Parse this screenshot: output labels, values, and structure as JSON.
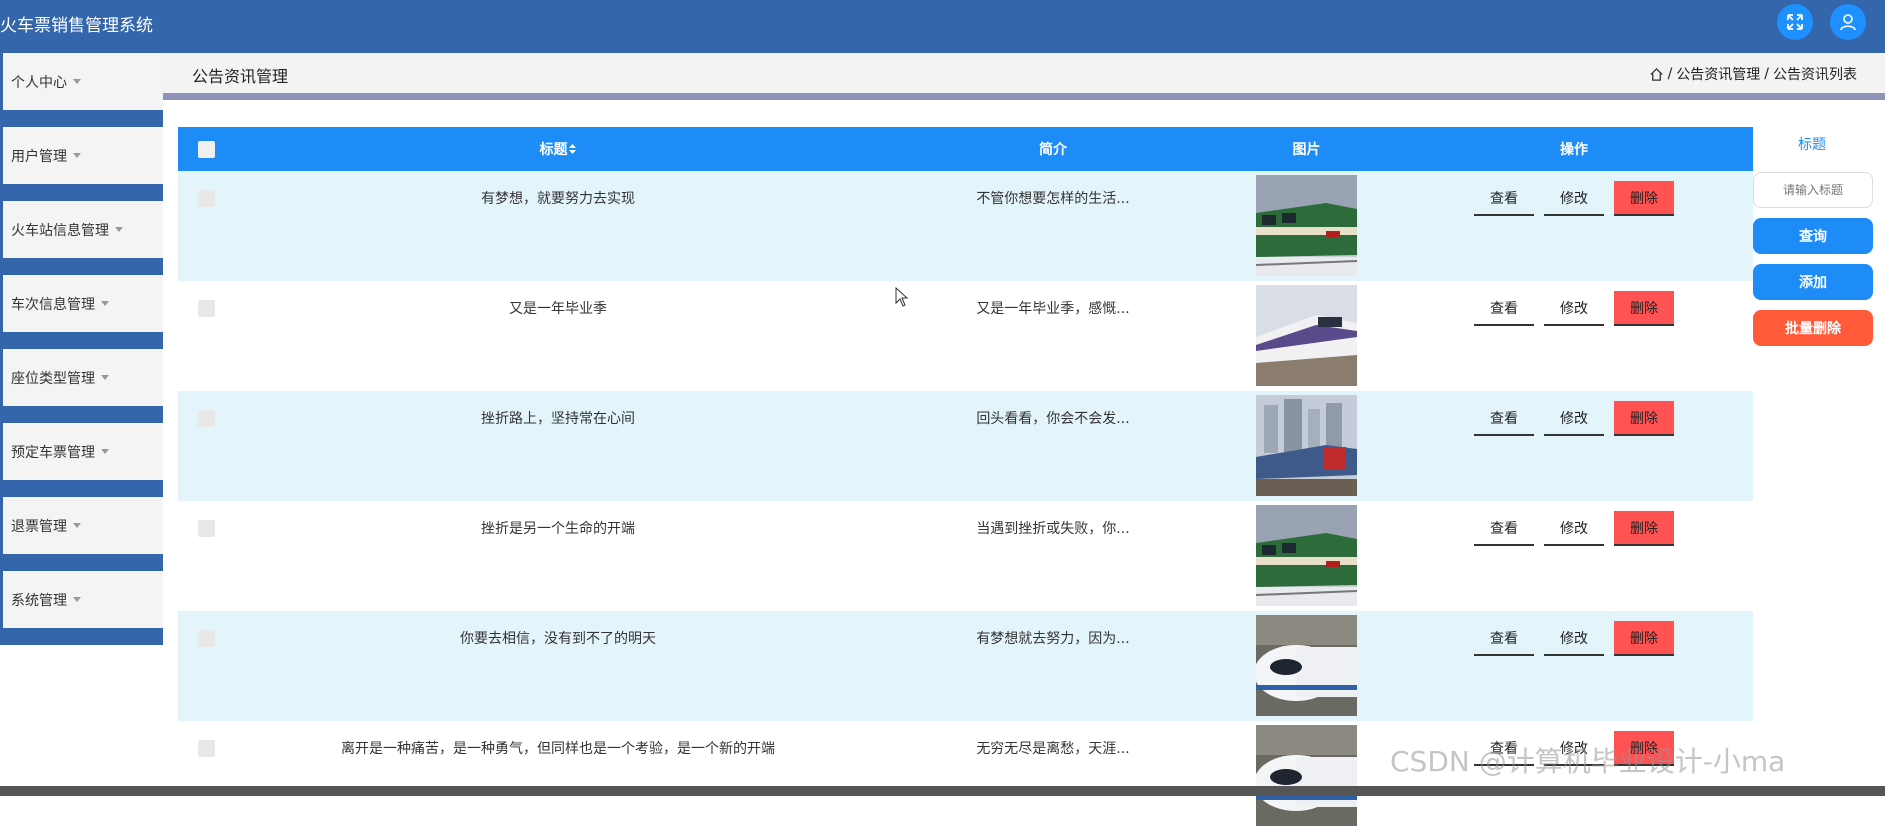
{
  "app": {
    "title": "火车票销售管理系统"
  },
  "topbar": {
    "icons": [
      "fullscreen-icon",
      "user-icon"
    ]
  },
  "sidebar": {
    "items": [
      {
        "label": "个人中心"
      },
      {
        "label": "用户管理"
      },
      {
        "label": "火车站信息管理"
      },
      {
        "label": "车次信息管理"
      },
      {
        "label": "座位类型管理"
      },
      {
        "label": "预定车票管理"
      },
      {
        "label": "退票管理"
      },
      {
        "label": "系统管理"
      }
    ]
  },
  "header": {
    "title": "公告资讯管理",
    "breadcrumb": [
      "公告资讯管理",
      "公告资讯列表"
    ],
    "breadcrumb_sep": "/"
  },
  "table": {
    "columns": {
      "title": "标题",
      "intro": "简介",
      "image": "图片",
      "action": "操作"
    },
    "sort_icon": "sort-icon",
    "actions": {
      "view": "查看",
      "edit": "修改",
      "delete": "删除"
    },
    "rows": [
      {
        "title": "有梦想，就要努力去实现",
        "intro": "不管你想要怎样的生活...",
        "image": "green-train"
      },
      {
        "title": "又是一年毕业季",
        "intro": "又是一年毕业季，感慨...",
        "image": "white-purple-train"
      },
      {
        "title": "挫折路上，坚持常在心间",
        "intro": "回头看看，你会不会发...",
        "image": "red-train-city"
      },
      {
        "title": "挫折是另一个生命的开端",
        "intro": "当遇到挫折或失败，你...",
        "image": "green-train"
      },
      {
        "title": "你要去相信，没有到不了的明天",
        "intro": "有梦想就去努力，因为...",
        "image": "high-speed-train"
      },
      {
        "title": "离开是一种痛苦，是一种勇气，但同样也是一个考验，是一个新的开端",
        "intro": "无穷无尽是离愁，天涯...",
        "image": "high-speed-train"
      }
    ]
  },
  "search": {
    "label": "标题",
    "placeholder": "请输入标题",
    "query_label": "查询",
    "add_label": "添加",
    "batch_delete_label": "批量删除"
  },
  "watermark": "CSDN @计算机毕业设计-小ma",
  "colors": {
    "topbar": "#3466ac",
    "primary": "#1e8cf7",
    "danger": "#ff5252",
    "row_alt": "#e3f5fb"
  }
}
